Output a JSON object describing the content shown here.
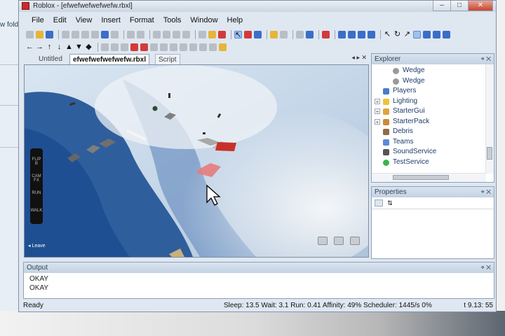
{
  "window": {
    "title": "Roblox - [efwefwefwefwefw.rbxl]",
    "controls": [
      "–",
      "□",
      "✕"
    ]
  },
  "background": {
    "left_text": "w fold"
  },
  "menu": [
    "File",
    "Edit",
    "View",
    "Insert",
    "Format",
    "Tools",
    "Window",
    "Help"
  ],
  "tabs": [
    {
      "label": "Untitled"
    },
    {
      "label": "efwefwefwefwefw.rbxl"
    },
    {
      "label": "Script"
    }
  ],
  "tab_nav": "◂ ▸ ✕",
  "viewport": {
    "hud_buttons": [
      "FLIP B",
      "CAM FX",
      "RUN",
      "WALK"
    ],
    "leave_label": "Leave"
  },
  "explorer": {
    "title": "Explorer",
    "items": [
      {
        "label": "Wedge",
        "icon": "wedge-icon",
        "indent": 2,
        "color": "#9a9a9a",
        "expandable": false
      },
      {
        "label": "Wedge",
        "icon": "wedge-icon",
        "indent": 2,
        "color": "#9a9a9a",
        "expandable": false
      },
      {
        "label": "Players",
        "icon": "players-icon",
        "indent": 1,
        "color": "#4a7ad0",
        "expandable": false
      },
      {
        "label": "Lighting",
        "icon": "lighting-icon",
        "indent": 1,
        "color": "#f0c23a",
        "expandable": true
      },
      {
        "label": "StarterGui",
        "icon": "startergui-icon",
        "indent": 1,
        "color": "#e0a43a",
        "expandable": true
      },
      {
        "label": "StarterPack",
        "icon": "starterpack-icon",
        "indent": 1,
        "color": "#c98a3a",
        "expandable": true
      },
      {
        "label": "Debris",
        "icon": "debris-icon",
        "indent": 1,
        "color": "#8f6b4a",
        "expandable": false
      },
      {
        "label": "Teams",
        "icon": "teams-icon",
        "indent": 1,
        "color": "#5b8ad8",
        "expandable": false
      },
      {
        "label": "SoundService",
        "icon": "soundservice-icon",
        "indent": 1,
        "color": "#555555",
        "expandable": false
      },
      {
        "label": "TestService",
        "icon": "testservice-icon",
        "indent": 1,
        "color": "#3bb54a",
        "expandable": false
      }
    ]
  },
  "properties": {
    "title": "Properties"
  },
  "output": {
    "title": "Output",
    "lines": [
      "OKAY",
      "OKAY"
    ]
  },
  "status": {
    "ready": "Ready",
    "stats": "Sleep: 13.5 Wait: 3.1 Run: 0.41 Affinity: 49% Scheduler: 1445/s 0%",
    "time": "t 9.13: 55"
  }
}
